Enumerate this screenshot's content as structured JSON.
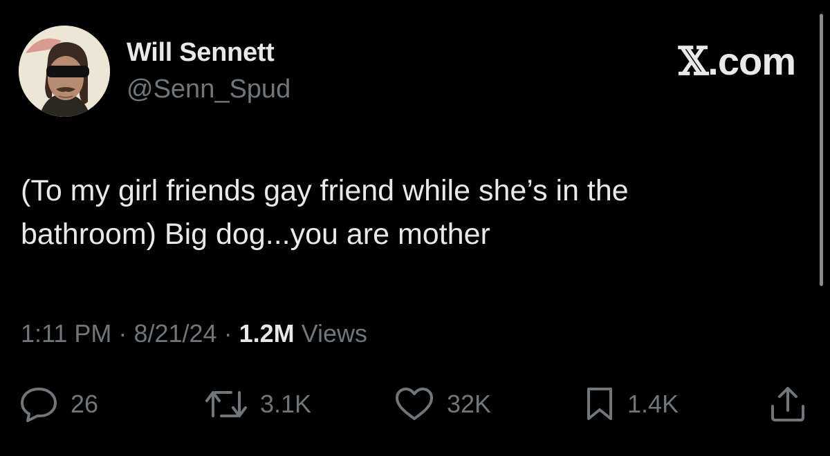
{
  "author": {
    "display_name": "Will Sennett",
    "handle": "@Senn_Spud",
    "avatar_icon": "profile-photo"
  },
  "brand": {
    "x_glyph": "𝕏",
    "suffix": ".com"
  },
  "tweet": {
    "text": "(To my girl friends gay friend while she’s in the\nbathroom) Big dog...you are mother"
  },
  "meta": {
    "time": "1:11 PM",
    "separator": "·",
    "date": "8/21/24",
    "views_count": "1.2M",
    "views_label": "Views"
  },
  "actions": {
    "reply": {
      "icon": "reply-icon",
      "count": "26"
    },
    "repost": {
      "icon": "repost-icon",
      "count": "3.1K"
    },
    "like": {
      "icon": "heart-icon",
      "count": "32K"
    },
    "bookmark": {
      "icon": "bookmark-icon",
      "count": "1.4K"
    },
    "share": {
      "icon": "share-icon"
    }
  },
  "colors": {
    "background": "#000000",
    "primary_text": "#e7e9ea",
    "secondary_text": "#71767b"
  }
}
